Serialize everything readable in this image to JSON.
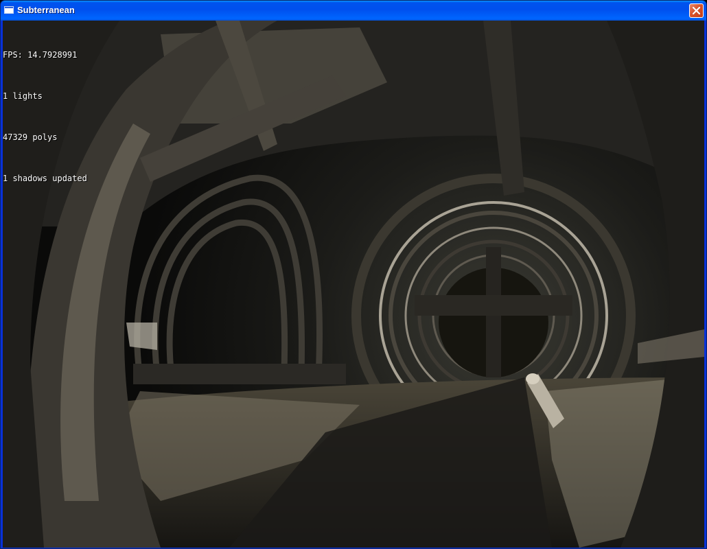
{
  "window": {
    "title": "Subterranean",
    "icon": "window-app-icon",
    "close_icon": "close-icon",
    "colors": {
      "titlebar": "#0054e3",
      "close_button": "#d9542c"
    }
  },
  "hud": {
    "fps": "FPS: 14.7928991",
    "lights": "1 lights",
    "polys": "47329 polys",
    "shadows": "1 shadows updated"
  }
}
